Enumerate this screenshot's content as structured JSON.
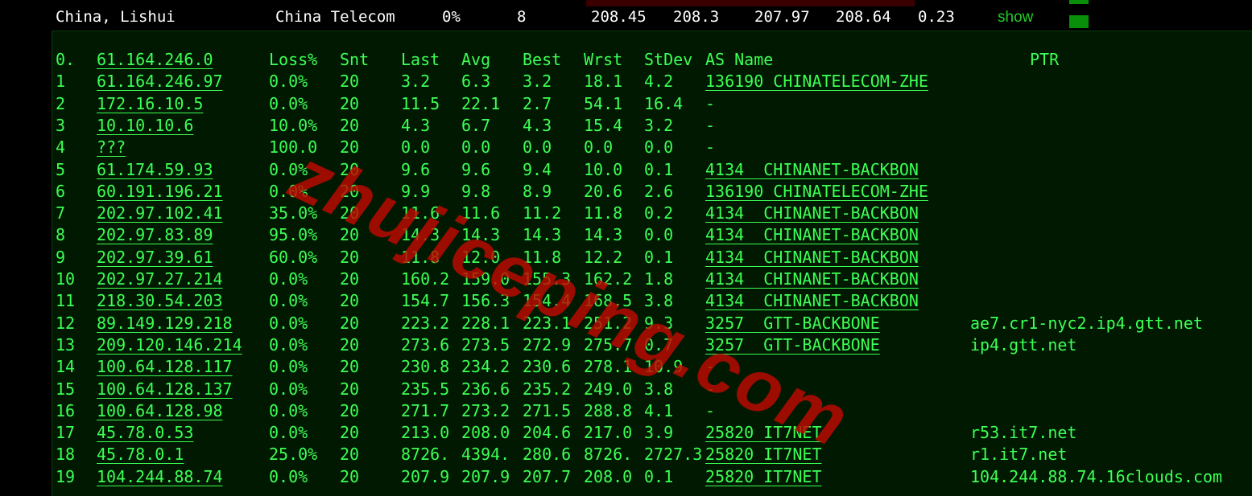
{
  "summary": {
    "location": "China, Lishui",
    "isp": "China Telecom",
    "loss": "0%",
    "sent": "8",
    "last": "208.45",
    "avg": "208.3",
    "best": "207.97",
    "worst": "208.64",
    "stdev": "0.23",
    "show_label": "show"
  },
  "colors": {
    "terminal_bg": "#001900",
    "text_green": "#3dff55",
    "watermark": "#be0a00",
    "show_green": "#22cc22"
  },
  "table": {
    "headers": {
      "hop": "0.",
      "host": "61.164.246.0",
      "loss": "Loss%",
      "snt": "Snt",
      "last": "Last",
      "avg": "Avg",
      "best": "Best",
      "wrst": "Wrst",
      "stdev": "StDev",
      "as": "AS Name",
      "ptr": "PTR"
    },
    "rows": [
      {
        "hop": "1",
        "host": "61.164.246.97",
        "loss": "0.0%",
        "snt": "20",
        "last": "3.2",
        "avg": "6.3",
        "best": "3.2",
        "wrst": "18.1",
        "stdev": "4.2",
        "as": "136190 CHINATELECOM-ZHE",
        "ptr": ""
      },
      {
        "hop": "2",
        "host": "172.16.10.5",
        "loss": "0.0%",
        "snt": "20",
        "last": "11.5",
        "avg": "22.1",
        "best": "2.7",
        "wrst": "54.1",
        "stdev": "16.4",
        "as": "-",
        "ptr": ""
      },
      {
        "hop": "3",
        "host": "10.10.10.6",
        "loss": "10.0%",
        "snt": "20",
        "last": "4.3",
        "avg": "6.7",
        "best": "4.3",
        "wrst": "15.4",
        "stdev": "3.2",
        "as": "-",
        "ptr": ""
      },
      {
        "hop": "4",
        "host": "???",
        "loss": "100.0",
        "snt": "20",
        "last": "0.0",
        "avg": "0.0",
        "best": "0.0",
        "wrst": "0.0",
        "stdev": "0.0",
        "as": "-",
        "ptr": ""
      },
      {
        "hop": "5",
        "host": "61.174.59.93",
        "loss": "0.0%",
        "snt": "20",
        "last": "9.6",
        "avg": "9.6",
        "best": "9.4",
        "wrst": "10.0",
        "stdev": "0.1",
        "as": "4134  CHINANET-BACKBON",
        "ptr": ""
      },
      {
        "hop": "6",
        "host": "60.191.196.21",
        "loss": "0.0%",
        "snt": "20",
        "last": "9.9",
        "avg": "9.8",
        "best": "8.9",
        "wrst": "20.6",
        "stdev": "2.6",
        "as": "136190 CHINATELECOM-ZHE",
        "ptr": ""
      },
      {
        "hop": "7",
        "host": "202.97.102.41",
        "loss": "35.0%",
        "snt": "20",
        "last": "11.6",
        "avg": "11.6",
        "best": "11.2",
        "wrst": "11.8",
        "stdev": "0.2",
        "as": "4134  CHINANET-BACKBON",
        "ptr": ""
      },
      {
        "hop": "8",
        "host": "202.97.83.89",
        "loss": "95.0%",
        "snt": "20",
        "last": "14.3",
        "avg": "14.3",
        "best": "14.3",
        "wrst": "14.3",
        "stdev": "0.0",
        "as": "4134  CHINANET-BACKBON",
        "ptr": ""
      },
      {
        "hop": "9",
        "host": "202.97.39.61",
        "loss": "60.0%",
        "snt": "20",
        "last": "11.8",
        "avg": "12.0",
        "best": "11.8",
        "wrst": "12.2",
        "stdev": "0.1",
        "as": "4134  CHINANET-BACKBON",
        "ptr": ""
      },
      {
        "hop": "10",
        "host": "202.97.27.214",
        "loss": "0.0%",
        "snt": "20",
        "last": "160.2",
        "avg": "159.0",
        "best": "155.3",
        "wrst": "162.2",
        "stdev": "1.8",
        "as": "4134  CHINANET-BACKBON",
        "ptr": ""
      },
      {
        "hop": "11",
        "host": "218.30.54.203",
        "loss": "0.0%",
        "snt": "20",
        "last": "154.7",
        "avg": "156.3",
        "best": "154.4",
        "wrst": "168.5",
        "stdev": "3.8",
        "as": "4134  CHINANET-BACKBON",
        "ptr": ""
      },
      {
        "hop": "12",
        "host": "89.149.129.218",
        "loss": "0.0%",
        "snt": "20",
        "last": "223.2",
        "avg": "228.1",
        "best": "223.1",
        "wrst": "251.2",
        "stdev": "9.3",
        "as": "3257  GTT-BACKBONE",
        "ptr": "ae7.cr1-nyc2.ip4.gtt.net"
      },
      {
        "hop": "13",
        "host": "209.120.146.214",
        "loss": "0.0%",
        "snt": "20",
        "last": "273.6",
        "avg": "273.5",
        "best": "272.9",
        "wrst": "275.7",
        "stdev": "0.7",
        "as": "3257  GTT-BACKBONE",
        "ptr": "ip4.gtt.net"
      },
      {
        "hop": "14",
        "host": "100.64.128.117",
        "loss": "0.0%",
        "snt": "20",
        "last": "230.8",
        "avg": "234.2",
        "best": "230.6",
        "wrst": "278.1",
        "stdev": "10.9",
        "as": "-",
        "ptr": ""
      },
      {
        "hop": "15",
        "host": "100.64.128.137",
        "loss": "0.0%",
        "snt": "20",
        "last": "235.5",
        "avg": "236.6",
        "best": "235.2",
        "wrst": "249.0",
        "stdev": "3.8",
        "as": "-",
        "ptr": ""
      },
      {
        "hop": "16",
        "host": "100.64.128.98",
        "loss": "0.0%",
        "snt": "20",
        "last": "271.7",
        "avg": "273.2",
        "best": "271.5",
        "wrst": "288.8",
        "stdev": "4.1",
        "as": "-",
        "ptr": ""
      },
      {
        "hop": "17",
        "host": "45.78.0.53",
        "loss": "0.0%",
        "snt": "20",
        "last": "213.0",
        "avg": "208.0",
        "best": "204.6",
        "wrst": "217.0",
        "stdev": "3.9",
        "as": "25820 IT7NET",
        "ptr": "r53.it7.net"
      },
      {
        "hop": "18",
        "host": "45.78.0.1",
        "loss": "25.0%",
        "snt": "20",
        "last": "8726.",
        "avg": "4394.",
        "best": "280.6",
        "wrst": "8726.",
        "stdev": "2727.3",
        "as": "25820 IT7NET",
        "ptr": "r1.it7.net"
      },
      {
        "hop": "19",
        "host": "104.244.88.74",
        "loss": "0.0%",
        "snt": "20",
        "last": "207.9",
        "avg": "207.9",
        "best": "207.7",
        "wrst": "208.0",
        "stdev": "0.1",
        "as": "25820 IT7NET",
        "ptr": "104.244.88.74.16clouds.com"
      }
    ]
  },
  "watermark": "zhujiceping.com"
}
